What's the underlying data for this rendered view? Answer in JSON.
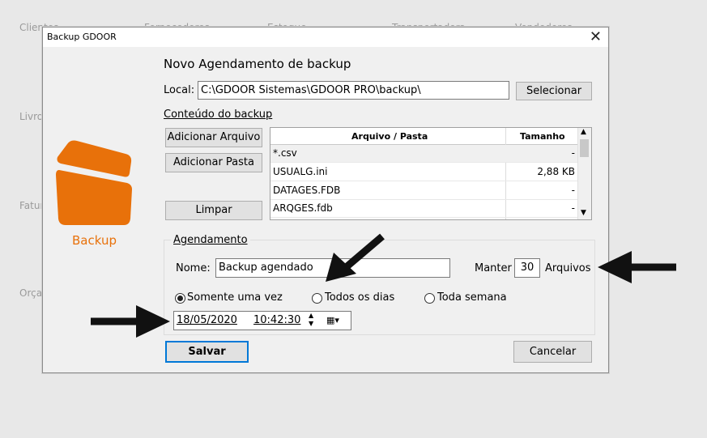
{
  "background": {
    "labels": [
      "Clientes",
      "Fornecedores",
      "Estoque",
      "Transportadora",
      "Vendedores",
      "Livro",
      "Fatur",
      "Orça"
    ]
  },
  "dialog": {
    "title": "Backup GDOOR",
    "heading": "Novo Agendamento de backup",
    "local_label": "Local:",
    "local_value": "C:\\GDOOR Sistemas\\GDOOR PRO\\backup\\",
    "select_button": "Selecionar",
    "content_link": "Conteúdo do backup",
    "add_file_button": "Adicionar Arquivo",
    "add_folder_button": "Adicionar Pasta",
    "clear_button": "Limpar",
    "logo_label": "Backup",
    "files_table": {
      "columns": [
        "Arquivo / Pasta",
        "Tamanho"
      ],
      "rows": [
        {
          "name": "*.csv",
          "size": "-"
        },
        {
          "name": "USUALG.ini",
          "size": "2,88 KB"
        },
        {
          "name": "DATAGES.FDB",
          "size": "-"
        },
        {
          "name": "ARQGES.fdb",
          "size": "-"
        }
      ]
    },
    "schedule": {
      "group_label": "Agendamento",
      "name_label": "Nome:",
      "name_value": "Backup agendado",
      "keep_label": "Manter",
      "keep_value": "30",
      "files_label": "Arquivos",
      "options": [
        "Somente uma vez",
        "Todos os dias",
        "Toda semana"
      ],
      "selected_option": "Somente uma vez",
      "date": "18/05/2020",
      "time": "10:42:30"
    },
    "save_button": "Salvar",
    "cancel_button": "Cancelar"
  },
  "colors": {
    "logo": "#e8710a",
    "accent_border": "#0078d7"
  }
}
